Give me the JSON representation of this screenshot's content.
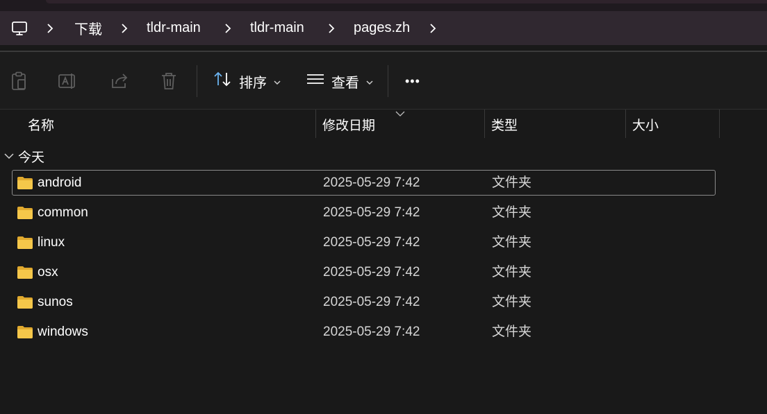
{
  "breadcrumb": {
    "items": [
      "下载",
      "tldr-main",
      "tldr-main",
      "pages.zh"
    ]
  },
  "toolbar": {
    "sort_label": "排序",
    "view_label": "查看",
    "more_label": "•••"
  },
  "columns": {
    "name": "名称",
    "date": "修改日期",
    "type": "类型",
    "size": "大小"
  },
  "group": {
    "label": "今天"
  },
  "files": [
    {
      "name": "android",
      "date": "2025-05-29 7:42",
      "type": "文件夹"
    },
    {
      "name": "common",
      "date": "2025-05-29 7:42",
      "type": "文件夹"
    },
    {
      "name": "linux",
      "date": "2025-05-29 7:42",
      "type": "文件夹"
    },
    {
      "name": "osx",
      "date": "2025-05-29 7:42",
      "type": "文件夹"
    },
    {
      "name": "sunos",
      "date": "2025-05-29 7:42",
      "type": "文件夹"
    },
    {
      "name": "windows",
      "date": "2025-05-29 7:42",
      "type": "文件夹"
    }
  ],
  "colors": {
    "background": "#191919",
    "addressbar": "#302830",
    "folder": "#f5c74a",
    "selection_border": "#8a8a8a"
  },
  "icons": [
    "computer-icon",
    "chevron-right-icon",
    "paste-icon",
    "rename-icon",
    "share-icon",
    "delete-icon",
    "sort-icon",
    "view-list-icon",
    "chevron-down-icon",
    "folder-icon"
  ]
}
